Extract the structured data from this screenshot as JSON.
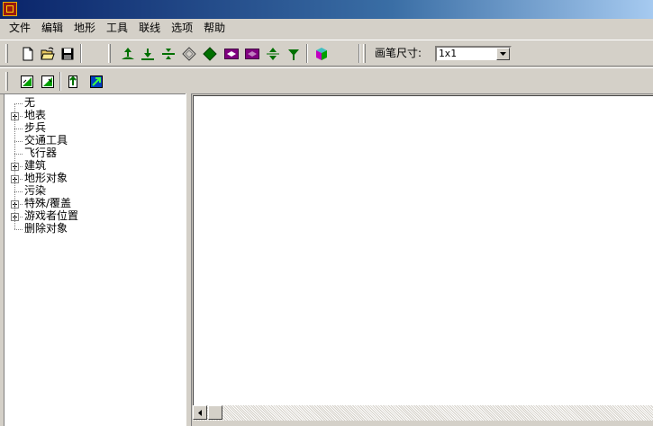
{
  "menu": [
    "文件",
    "编辑",
    "地形",
    "工具",
    "联线",
    "选项",
    "帮助"
  ],
  "toolbar": {
    "pen_size_label": "画笔尺寸:",
    "pen_size_value": "1x1",
    "file_buttons": [
      "new-file-icon",
      "open-folder-icon",
      "save-disk-icon"
    ],
    "terrain_buttons": [
      "raise-terrain-icon",
      "lower-terrain-icon",
      "flatten-terrain-icon",
      "smooth-diamond-outline-icon",
      "green-diamond-icon",
      "purple-raise-icon",
      "purple-lower-icon",
      "green-up-down-icon",
      "green-down-icon",
      "cube-icon"
    ],
    "second_row_buttons": [
      "copy-layer-icon",
      "paste-layer-icon",
      "insert-icon",
      "export-icon"
    ]
  },
  "tree": [
    {
      "label": "无",
      "expandable": false
    },
    {
      "label": "地表",
      "expandable": true
    },
    {
      "label": "步兵",
      "expandable": false
    },
    {
      "label": "交通工具",
      "expandable": false
    },
    {
      "label": "飞行器",
      "expandable": false
    },
    {
      "label": "建筑",
      "expandable": true
    },
    {
      "label": "地形对象",
      "expandable": true
    },
    {
      "label": "污染",
      "expandable": false
    },
    {
      "label": "特殊/覆盖",
      "expandable": true
    },
    {
      "label": "游戏者位置",
      "expandable": true
    },
    {
      "label": "删除对象",
      "expandable": false
    }
  ]
}
